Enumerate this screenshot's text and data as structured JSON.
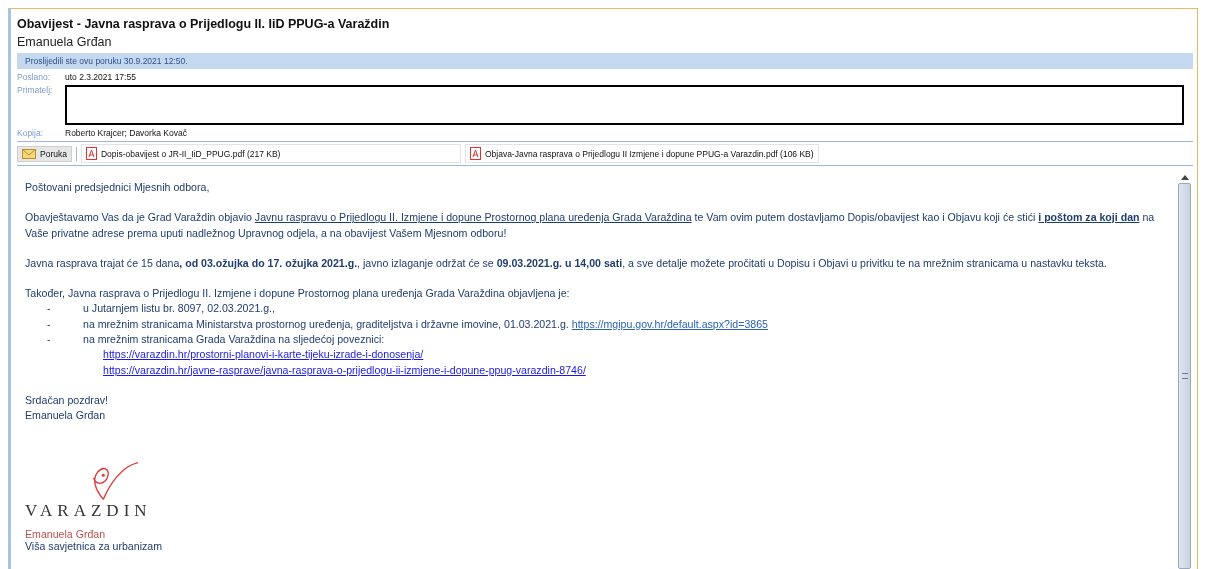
{
  "message": {
    "subject": "Obavijest - Javna rasprava o Prijedlogu II. IiD PPUG-a Varaždin",
    "sender": "Emanuela Grđan",
    "info_bar": "Proslijedili ste ovu poruku 30.9.2021 12:50.",
    "sent_label": "Poslano:",
    "sent_value": "uto 2.3.2021 17:55",
    "to_label": "Primatelj:",
    "cc_label": "Kopija:",
    "cc_value": "Roberto Krajcer; Davorka  Kovač"
  },
  "attachments": [
    {
      "kind": "message",
      "label": "Poruka",
      "selected": true
    },
    {
      "kind": "pdf",
      "label": "Dopis-obavijest o JR-II_IiD_PPUG.pdf (217 KB)",
      "selected": false
    },
    {
      "kind": "pdf",
      "label": "Objava-Javna rasprava o Prijedlogu II Izmjene i dopune PPUG-a Varazdin.pdf (106 KB)",
      "selected": false
    }
  ],
  "body": [
    {
      "kind": "para",
      "segments": [
        {
          "kind": "plain",
          "text": "Poštovani predsjednici Mjesnih odbora,"
        }
      ]
    },
    {
      "kind": "para",
      "segments": [
        {
          "kind": "plain",
          "text": "Obavještavamo Vas da je Grad Varaždin objavio "
        },
        {
          "kind": "underline",
          "text": "Javnu raspravu o Prijedlogu II. Izmjene i dopune Prostornog plana uređenja Grada Varaždina"
        },
        {
          "kind": "plain",
          "text": " te Vam ovim putem dostavljamo Dopis/obavijest kao i Objavu koji će stići "
        },
        {
          "kind": "underline",
          "text": "**i poštom za koji dan**"
        },
        {
          "kind": "plain",
          "text": " na Vaše privatne adrese prema uputi nadležnog Upravnog odjela, a na obavijest Vašem Mjesnom odboru!"
        }
      ]
    },
    {
      "kind": "para",
      "segments": [
        {
          "kind": "plain",
          "text": "Javna rasprava  trajat će 15 dana**, od 03.ožujka do 17. ožujka 2021.g.**, javno izlaganje održat će se **09.03.2021.g. u 14,00 sati**, a sve detalje možete pročitati u Dopisu i Objavi u privitku te na mrežnim stranicama u nastavku teksta."
        }
      ]
    },
    {
      "kind": "line",
      "segments": [
        {
          "kind": "plain",
          "text": "Također, Javna rasprava o Prijedlogu II. Izmjene i dopune Prostornog plana uređenja Grada Varaždina objavljena je:"
        }
      ]
    },
    {
      "kind": "bullet",
      "marker": "-",
      "segments": [
        {
          "kind": "plain",
          "text": "u Jutarnjem listu br. 8097, 02.03.2021.g.,"
        }
      ]
    },
    {
      "kind": "bullet",
      "marker": "-",
      "segments": [
        {
          "kind": "plain",
          "text": "na mrežnim stranicama Ministarstva prostornog uređenja,  graditeljstva i državne imovine, 01.03.2021.g. "
        },
        {
          "kind": "url",
          "text": "https://mgipu.gov.hr/default.aspx?id=3865"
        }
      ]
    },
    {
      "kind": "bullet",
      "marker": "-",
      "segments": [
        {
          "kind": "plain",
          "text": "na mrežnim stranicama Grada Varaždina na sljedećoj poveznici:"
        }
      ]
    },
    {
      "kind": "urlline",
      "segments": [
        {
          "kind": "url",
          "text": "https://varazdin.hr/prostorni-planovi-i-karte-tijeku-izrade-i-donosenja/"
        }
      ]
    },
    {
      "kind": "urlline",
      "segments": [
        {
          "kind": "url",
          "text": "https://varazdin.hr/javne-rasprave/javna-rasprava-o-prijedlogu-ii-izmjene-i-dopune-ppug-varazdin-8746/"
        }
      ]
    },
    {
      "kind": "line",
      "segments": [
        {
          "kind": "plain",
          "text": "Srdačan pozdrav!"
        }
      ]
    },
    {
      "kind": "line",
      "segments": [
        {
          "kind": "plain",
          "text": "Emanuela Grđan"
        }
      ]
    }
  ],
  "signature": {
    "logo_text": "VARAZDIN",
    "name": "Emanuela Grđan",
    "title": "Viša savjetnica za urbanizam"
  }
}
